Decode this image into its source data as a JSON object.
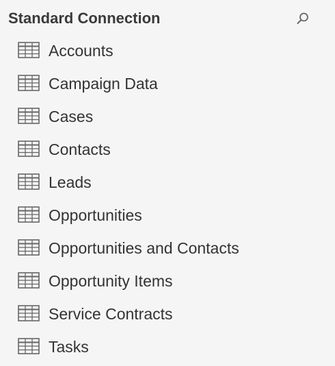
{
  "panel": {
    "title": "Standard Connection",
    "search_icon": "search-icon",
    "table_icon": "table-grid-icon",
    "colors": {
      "background": "#f5f5f5",
      "text": "#333333",
      "icon": "#666666"
    },
    "tables": [
      {
        "label": "Accounts"
      },
      {
        "label": "Campaign Data"
      },
      {
        "label": "Cases"
      },
      {
        "label": "Contacts"
      },
      {
        "label": "Leads"
      },
      {
        "label": "Opportunities"
      },
      {
        "label": "Opportunities and Contacts"
      },
      {
        "label": "Opportunity Items"
      },
      {
        "label": "Service Contracts"
      },
      {
        "label": "Tasks"
      }
    ]
  }
}
